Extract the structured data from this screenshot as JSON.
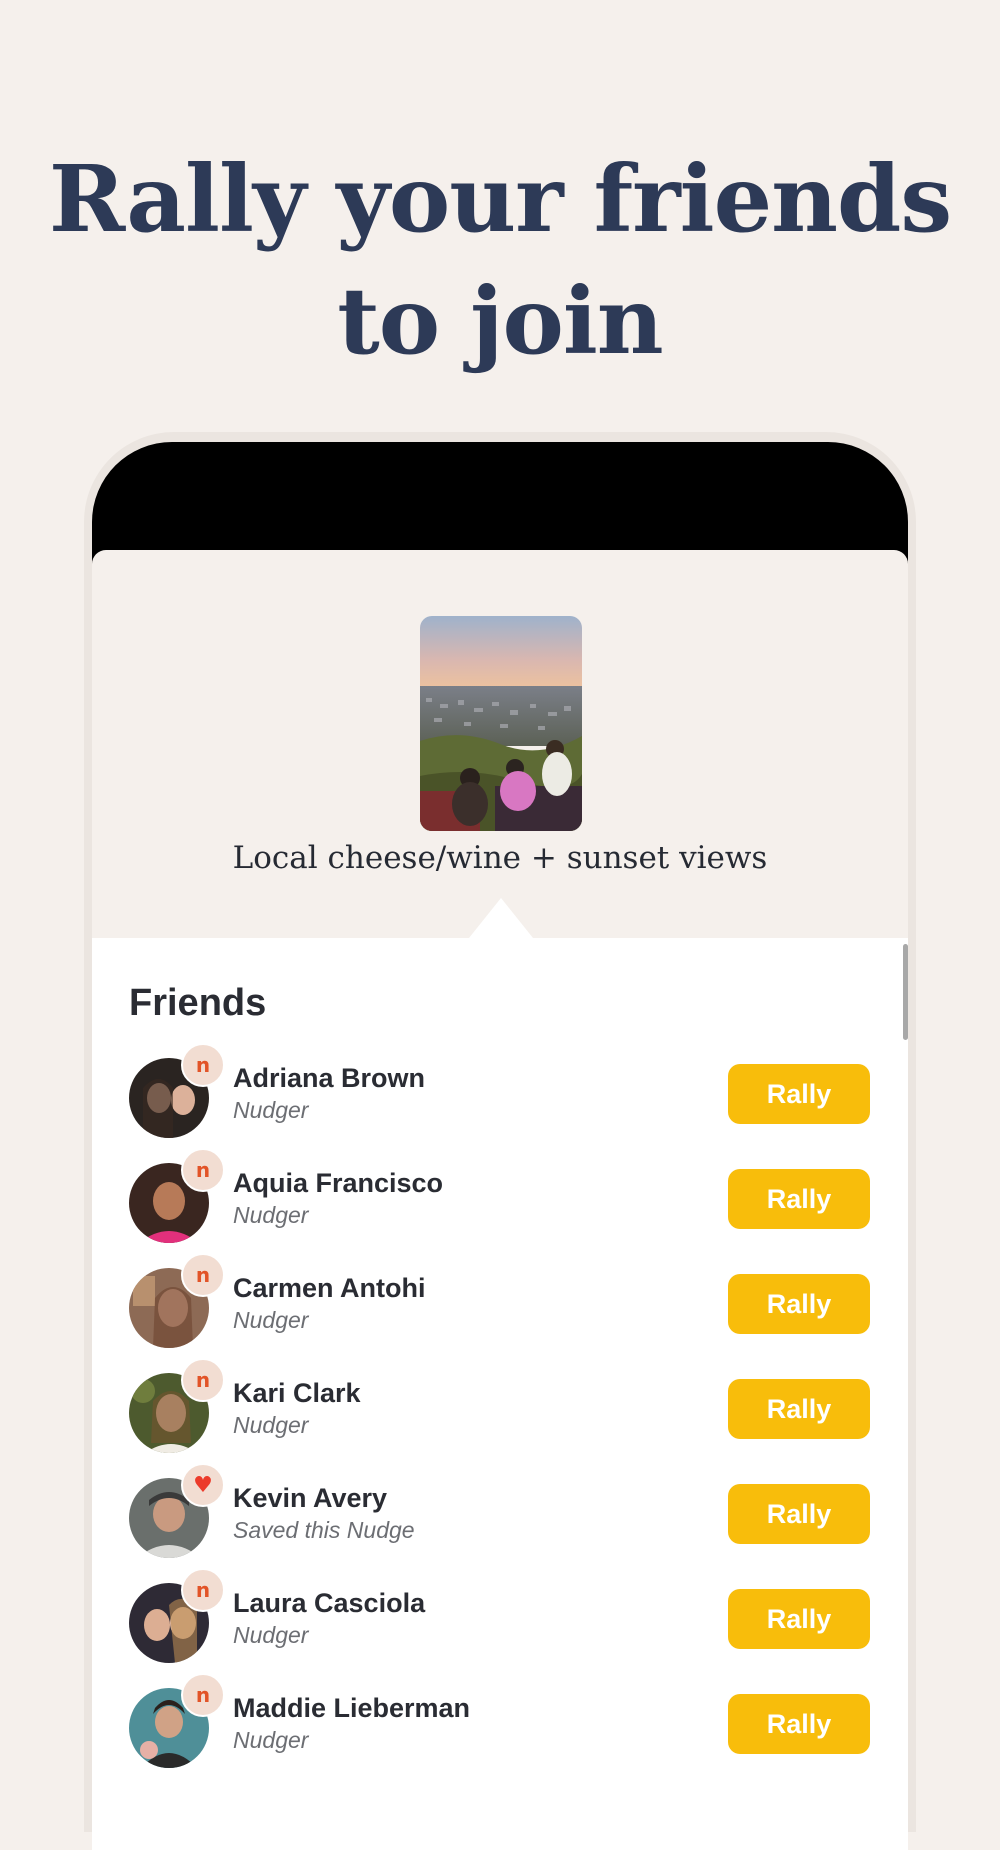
{
  "headline": {
    "line1": "Rally your friends",
    "line2": "to join"
  },
  "nudge": {
    "title": "Local cheese/wine + sunset views"
  },
  "friends_section": {
    "title": "Friends",
    "items": [
      {
        "name": "Adriana Brown",
        "status": "Nudger",
        "badge": "n",
        "rally_label": "Rally"
      },
      {
        "name": "Aquia Francisco",
        "status": "Nudger",
        "badge": "n",
        "rally_label": "Rally"
      },
      {
        "name": "Carmen Antohi",
        "status": "Nudger",
        "badge": "n",
        "rally_label": "Rally"
      },
      {
        "name": "Kari Clark",
        "status": "Nudger",
        "badge": "n",
        "rally_label": "Rally"
      },
      {
        "name": "Kevin Avery",
        "status": "Saved this Nudge",
        "badge": "♥",
        "rally_label": "Rally"
      },
      {
        "name": "Laura Casciola",
        "status": "Nudger",
        "badge": "n",
        "rally_label": "Rally"
      },
      {
        "name": "Maddie Lieberman",
        "status": "Nudger",
        "badge": "n",
        "rally_label": "Rally"
      }
    ]
  },
  "colors": {
    "background": "#f5f0ec",
    "headline": "#2d3a57",
    "rally_button": "#f8bd0b",
    "badge_accent": "#e25428",
    "heart": "#ec3b2b"
  }
}
